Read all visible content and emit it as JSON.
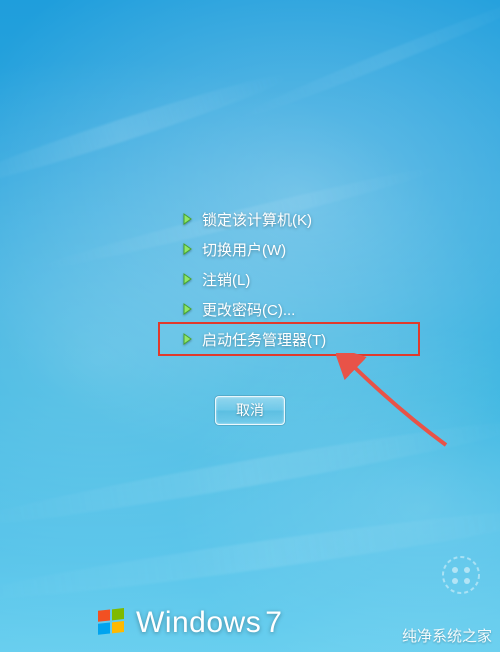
{
  "menu": {
    "items": [
      {
        "label": "锁定该计算机(K)",
        "name": "menu-lock-computer"
      },
      {
        "label": "切换用户(W)",
        "name": "menu-switch-user"
      },
      {
        "label": "注销(L)",
        "name": "menu-log-off"
      },
      {
        "label": "更改密码(C)...",
        "name": "menu-change-password"
      },
      {
        "label": "启动任务管理器(T)",
        "name": "menu-start-task-manager"
      }
    ]
  },
  "cancel_label": "取消",
  "brand": {
    "name": "Windows",
    "version": "7"
  },
  "watermark_text": "纯净系统之家",
  "highlight_index": 4,
  "colors": {
    "highlight_border": "#e03a2c",
    "pointer": "#e85348"
  }
}
